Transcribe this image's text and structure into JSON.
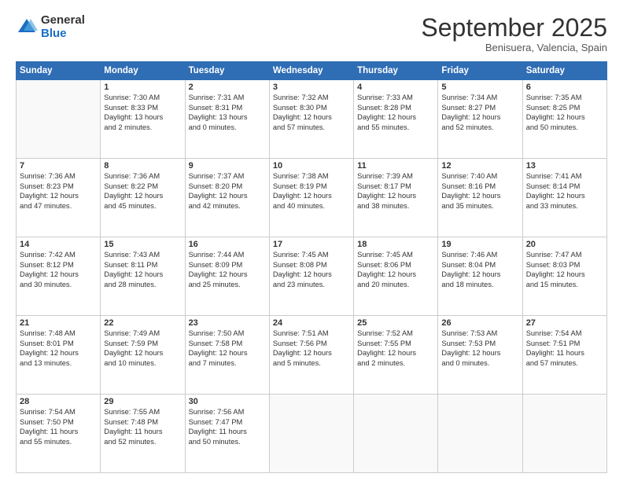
{
  "logo": {
    "general": "General",
    "blue": "Blue"
  },
  "title": "September 2025",
  "location": "Benisuera, Valencia, Spain",
  "weekdays": [
    "Sunday",
    "Monday",
    "Tuesday",
    "Wednesday",
    "Thursday",
    "Friday",
    "Saturday"
  ],
  "weeks": [
    [
      {
        "day": "",
        "info": ""
      },
      {
        "day": "1",
        "info": "Sunrise: 7:30 AM\nSunset: 8:33 PM\nDaylight: 13 hours\nand 2 minutes."
      },
      {
        "day": "2",
        "info": "Sunrise: 7:31 AM\nSunset: 8:31 PM\nDaylight: 13 hours\nand 0 minutes."
      },
      {
        "day": "3",
        "info": "Sunrise: 7:32 AM\nSunset: 8:30 PM\nDaylight: 12 hours\nand 57 minutes."
      },
      {
        "day": "4",
        "info": "Sunrise: 7:33 AM\nSunset: 8:28 PM\nDaylight: 12 hours\nand 55 minutes."
      },
      {
        "day": "5",
        "info": "Sunrise: 7:34 AM\nSunset: 8:27 PM\nDaylight: 12 hours\nand 52 minutes."
      },
      {
        "day": "6",
        "info": "Sunrise: 7:35 AM\nSunset: 8:25 PM\nDaylight: 12 hours\nand 50 minutes."
      }
    ],
    [
      {
        "day": "7",
        "info": "Sunrise: 7:36 AM\nSunset: 8:23 PM\nDaylight: 12 hours\nand 47 minutes."
      },
      {
        "day": "8",
        "info": "Sunrise: 7:36 AM\nSunset: 8:22 PM\nDaylight: 12 hours\nand 45 minutes."
      },
      {
        "day": "9",
        "info": "Sunrise: 7:37 AM\nSunset: 8:20 PM\nDaylight: 12 hours\nand 42 minutes."
      },
      {
        "day": "10",
        "info": "Sunrise: 7:38 AM\nSunset: 8:19 PM\nDaylight: 12 hours\nand 40 minutes."
      },
      {
        "day": "11",
        "info": "Sunrise: 7:39 AM\nSunset: 8:17 PM\nDaylight: 12 hours\nand 38 minutes."
      },
      {
        "day": "12",
        "info": "Sunrise: 7:40 AM\nSunset: 8:16 PM\nDaylight: 12 hours\nand 35 minutes."
      },
      {
        "day": "13",
        "info": "Sunrise: 7:41 AM\nSunset: 8:14 PM\nDaylight: 12 hours\nand 33 minutes."
      }
    ],
    [
      {
        "day": "14",
        "info": "Sunrise: 7:42 AM\nSunset: 8:12 PM\nDaylight: 12 hours\nand 30 minutes."
      },
      {
        "day": "15",
        "info": "Sunrise: 7:43 AM\nSunset: 8:11 PM\nDaylight: 12 hours\nand 28 minutes."
      },
      {
        "day": "16",
        "info": "Sunrise: 7:44 AM\nSunset: 8:09 PM\nDaylight: 12 hours\nand 25 minutes."
      },
      {
        "day": "17",
        "info": "Sunrise: 7:45 AM\nSunset: 8:08 PM\nDaylight: 12 hours\nand 23 minutes."
      },
      {
        "day": "18",
        "info": "Sunrise: 7:45 AM\nSunset: 8:06 PM\nDaylight: 12 hours\nand 20 minutes."
      },
      {
        "day": "19",
        "info": "Sunrise: 7:46 AM\nSunset: 8:04 PM\nDaylight: 12 hours\nand 18 minutes."
      },
      {
        "day": "20",
        "info": "Sunrise: 7:47 AM\nSunset: 8:03 PM\nDaylight: 12 hours\nand 15 minutes."
      }
    ],
    [
      {
        "day": "21",
        "info": "Sunrise: 7:48 AM\nSunset: 8:01 PM\nDaylight: 12 hours\nand 13 minutes."
      },
      {
        "day": "22",
        "info": "Sunrise: 7:49 AM\nSunset: 7:59 PM\nDaylight: 12 hours\nand 10 minutes."
      },
      {
        "day": "23",
        "info": "Sunrise: 7:50 AM\nSunset: 7:58 PM\nDaylight: 12 hours\nand 7 minutes."
      },
      {
        "day": "24",
        "info": "Sunrise: 7:51 AM\nSunset: 7:56 PM\nDaylight: 12 hours\nand 5 minutes."
      },
      {
        "day": "25",
        "info": "Sunrise: 7:52 AM\nSunset: 7:55 PM\nDaylight: 12 hours\nand 2 minutes."
      },
      {
        "day": "26",
        "info": "Sunrise: 7:53 AM\nSunset: 7:53 PM\nDaylight: 12 hours\nand 0 minutes."
      },
      {
        "day": "27",
        "info": "Sunrise: 7:54 AM\nSunset: 7:51 PM\nDaylight: 11 hours\nand 57 minutes."
      }
    ],
    [
      {
        "day": "28",
        "info": "Sunrise: 7:54 AM\nSunset: 7:50 PM\nDaylight: 11 hours\nand 55 minutes."
      },
      {
        "day": "29",
        "info": "Sunrise: 7:55 AM\nSunset: 7:48 PM\nDaylight: 11 hours\nand 52 minutes."
      },
      {
        "day": "30",
        "info": "Sunrise: 7:56 AM\nSunset: 7:47 PM\nDaylight: 11 hours\nand 50 minutes."
      },
      {
        "day": "",
        "info": ""
      },
      {
        "day": "",
        "info": ""
      },
      {
        "day": "",
        "info": ""
      },
      {
        "day": "",
        "info": ""
      }
    ]
  ]
}
